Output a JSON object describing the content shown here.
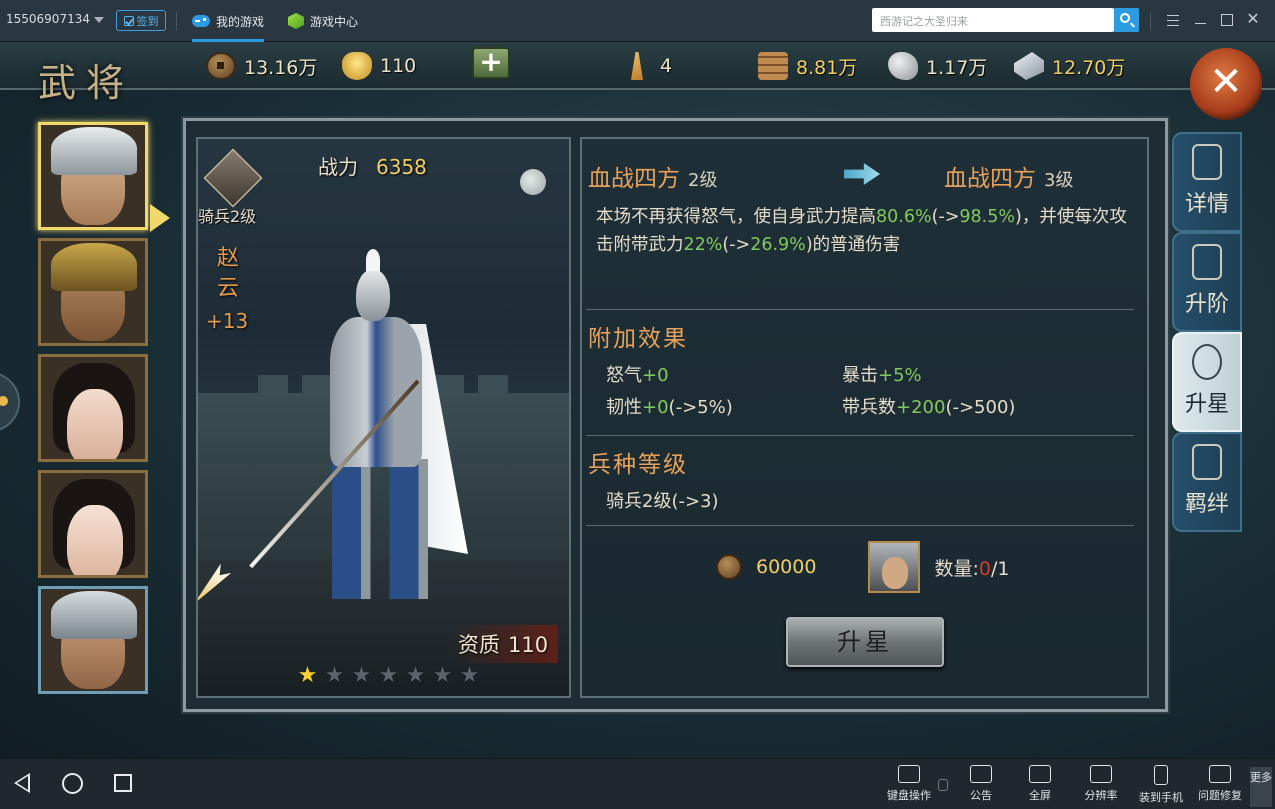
{
  "topbar": {
    "account": "15506907134",
    "signin_label": "签到",
    "tabs": [
      {
        "label": "我的游戏",
        "icon": "gamepad-icon"
      },
      {
        "label": "游戏中心",
        "icon": "cube-icon"
      }
    ],
    "search_placeholder": "西游记之大圣归来"
  },
  "game": {
    "page_title": "武将",
    "resources": [
      {
        "name": "copper-coin",
        "value": "13.16万"
      },
      {
        "name": "gold-ingot",
        "value": "110"
      },
      {
        "name": "food",
        "value": "4"
      },
      {
        "name": "wood",
        "value": "8.81万"
      },
      {
        "name": "stone",
        "value": "1.17万"
      },
      {
        "name": "iron",
        "value": "12.70万"
      }
    ],
    "hero": {
      "class_label": "骑兵2级",
      "power_label": "战力",
      "power_value": "6358",
      "name": "赵云",
      "level_bonus": "+13",
      "aptitude_label": "资质",
      "aptitude_value": "110",
      "stars_total": 7,
      "stars_filled": 1
    },
    "skill": {
      "current_name": "血战四方",
      "current_level": "2级",
      "next_name": "血战四方",
      "next_level": "3级",
      "desc_parts": [
        {
          "text": "本场不再获得怒气，使自身武力提高",
          "hl": false
        },
        {
          "text": "80.6%",
          "hl": true
        },
        {
          "text": "(->",
          "hl": false
        },
        {
          "text": "98.5%",
          "hl": true
        },
        {
          "text": ")，并使每次攻击附带武力",
          "hl": false
        },
        {
          "text": "22%",
          "hl": true
        },
        {
          "text": "(->",
          "hl": false
        },
        {
          "text": "26.9%",
          "hl": true
        },
        {
          "text": ")的普通伤害",
          "hl": false
        }
      ]
    },
    "extra_effects": {
      "title": "附加效果",
      "stats": [
        {
          "label": "怒气",
          "value": "+0",
          "after": ""
        },
        {
          "label": "暴击",
          "value": "+5%",
          "after": ""
        },
        {
          "label": "韧性",
          "value": "+0",
          "after": "(->5%)"
        },
        {
          "label": "带兵数",
          "value": "+200",
          "after": "(->500)"
        }
      ]
    },
    "troop_level": {
      "title": "兵种等级",
      "value": "骑兵2级(->3)"
    },
    "cost": {
      "coins": "60000",
      "qty_label": "数量:",
      "qty_have": "0",
      "qty_need": "/1"
    },
    "star_up_button": "升星",
    "side_tabs": [
      {
        "label": "详情",
        "icon": "scroll-icon",
        "active": false
      },
      {
        "label": "升阶",
        "icon": "upgrade-arrow-icon",
        "active": false
      },
      {
        "label": "升星",
        "icon": "taiji-icon",
        "active": true
      },
      {
        "label": "羁绊",
        "icon": "bond-figures-icon",
        "active": false
      }
    ]
  },
  "bottombar": {
    "tools": [
      {
        "label": "键盘操作",
        "icon": "keyboard-icon"
      },
      {
        "label": "公告",
        "icon": "announcement-icon"
      },
      {
        "label": "全屏",
        "icon": "fullscreen-icon"
      },
      {
        "label": "分辨率",
        "icon": "resolution-icon"
      },
      {
        "label": "装到手机",
        "icon": "phone-icon"
      },
      {
        "label": "问题修复",
        "icon": "repair-icon"
      }
    ],
    "more_label": "更多"
  }
}
